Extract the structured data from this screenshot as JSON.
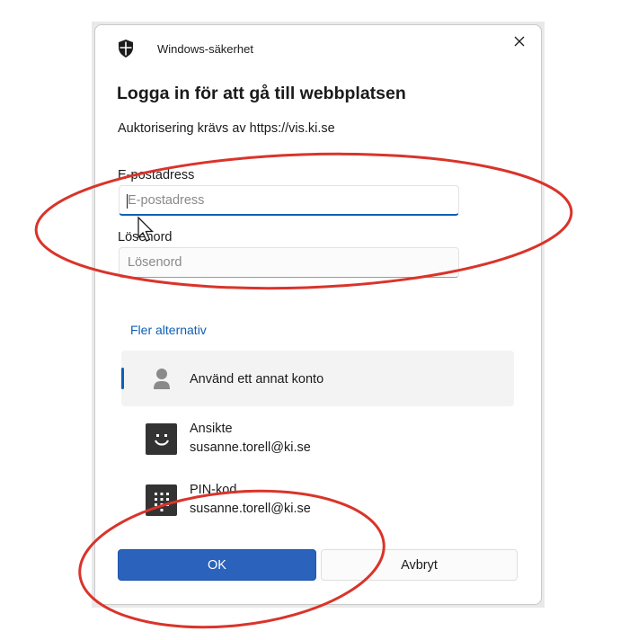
{
  "dialog": {
    "app_title": "Windows-säkerhet",
    "heading": "Logga in för att gå till webbplatsen",
    "subheading": "Auktorisering krävs av https://vis.ki.se"
  },
  "form": {
    "email_label": "E-postadress",
    "email_placeholder": "E-postadress",
    "email_value": "",
    "password_label": "Lösenord",
    "password_placeholder": "Lösenord",
    "password_value": ""
  },
  "more_options": {
    "link_label": "Fler alternativ",
    "items": [
      {
        "label": "Använd ett annat konto",
        "sub": "",
        "icon": "person-icon",
        "selected": true
      },
      {
        "label": "Ansikte",
        "sub": "susanne.torell@ki.se",
        "icon": "face-icon",
        "selected": false
      },
      {
        "label": "PIN-kod",
        "sub": "susanne.torell@ki.se",
        "icon": "pin-keypad-icon",
        "selected": false
      }
    ]
  },
  "buttons": {
    "ok_label": "OK",
    "cancel_label": "Avbryt"
  },
  "colors": {
    "accent": "#0f5fb5",
    "ok_button": "#2a62bc",
    "annotation_circle": "#d9342b",
    "tile_icon_bg": "#333333"
  }
}
